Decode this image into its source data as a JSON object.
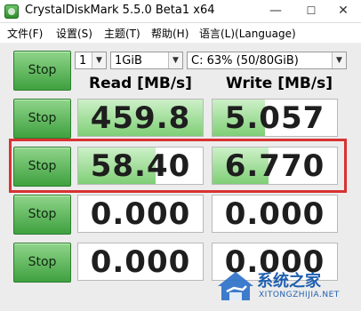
{
  "window": {
    "title": "CrystalDiskMark 5.5.0 Beta1 x64",
    "controls": [
      "—",
      "☐",
      "✕"
    ]
  },
  "menu": [
    "文件(F)",
    "设置(S)",
    "主题(T)",
    "帮助(H)",
    "语言(L)(Language)"
  ],
  "settings": {
    "count": "1",
    "size": "1GiB",
    "drive": "C: 63% (50/80GiB)"
  },
  "headers": {
    "read": "Read [MB/s]",
    "write": "Write [MB/s]"
  },
  "rows": [
    {
      "stop_label": "Stop",
      "read": "459.8",
      "write": "5.057",
      "read_fill": 1.0,
      "write_fill": 0.42
    },
    {
      "stop_label": "Stop",
      "read": "58.40",
      "write": "6.770",
      "read_fill": 0.62,
      "write_fill": 0.45
    },
    {
      "stop_label": "Stop",
      "read": "0.000",
      "write": "0.000",
      "read_fill": 0.0,
      "write_fill": 0.0
    },
    {
      "stop_label": "Stop",
      "read": "0.000",
      "write": "0.000",
      "read_fill": 0.0,
      "write_fill": 0.0
    }
  ],
  "top_stop_label": "Stop",
  "watermark": {
    "name": "系统之家",
    "domain": "XITONGZHIJIA.NET"
  },
  "colors": {
    "highlight": "#d93232",
    "bar": "#7fcf76"
  }
}
